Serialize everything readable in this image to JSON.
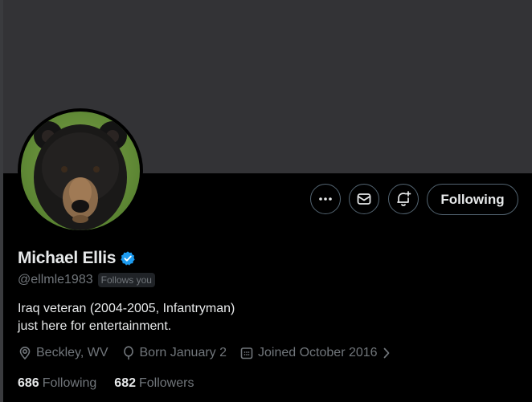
{
  "profile": {
    "name": "Michael Ellis",
    "handle": "@ellmle1983",
    "follows_you": "Follows you",
    "bio_line1": "Iraq veteran (2004-2005, Infantryman)",
    "bio_line2": "just here for entertainment.",
    "location": "Beckley, WV",
    "birthday": "Born January 2",
    "joined": "Joined October 2016",
    "avatar_icon": "bear-photo"
  },
  "actions": {
    "more_icon": "more-dots-icon",
    "message_icon": "mail-icon",
    "notify_icon": "bell-plus-icon",
    "following_label": "Following"
  },
  "stats": {
    "following_count": "686",
    "following_label": "Following",
    "followers_count": "682",
    "followers_label": "Followers"
  },
  "colors": {
    "background": "#000000",
    "banner": "#333336",
    "verified": "#1d9bf0",
    "muted_text": "#71767b",
    "primary_text": "#e7e9ea"
  }
}
